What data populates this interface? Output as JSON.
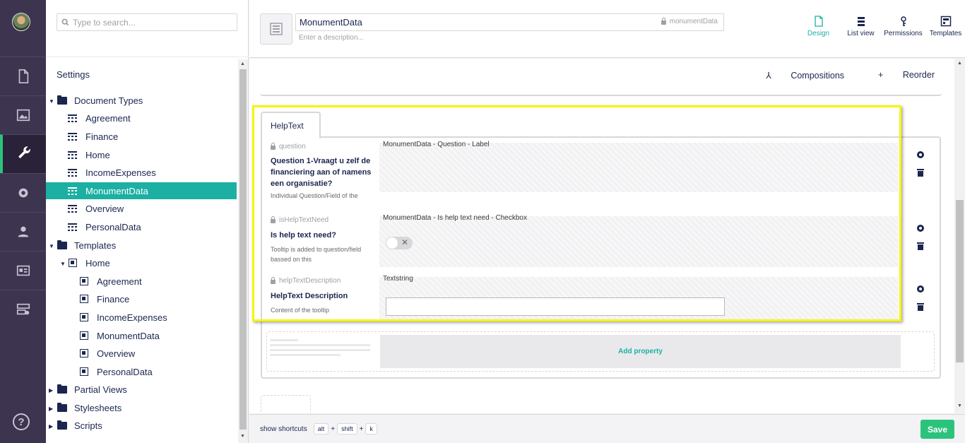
{
  "search": {
    "placeholder": "Type to search..."
  },
  "tree": {
    "section_title": "Settings",
    "document_types": {
      "label": "Document Types",
      "items": [
        "Agreement",
        "Finance",
        "Home",
        "IncomeExpenses",
        "MonumentData",
        "Overview",
        "PersonalData"
      ],
      "selected": "MonumentData"
    },
    "templates": {
      "label": "Templates",
      "home": "Home",
      "items": [
        "Agreement",
        "Finance",
        "IncomeExpenses",
        "MonumentData",
        "Overview",
        "PersonalData"
      ]
    },
    "partial_views": "Partial Views",
    "stylesheets": "Stylesheets",
    "scripts": "Scripts"
  },
  "header": {
    "name": "MonumentData",
    "alias": "monumentData",
    "description_placeholder": "Enter a description...",
    "apps": [
      {
        "label": "Design",
        "icon": "document-icon",
        "active": true
      },
      {
        "label": "List view",
        "icon": "list-view-icon",
        "active": false
      },
      {
        "label": "Permissions",
        "icon": "permissions-icon",
        "active": false
      },
      {
        "label": "Templates",
        "icon": "templates-icon",
        "active": false
      }
    ]
  },
  "toolbar": {
    "compositions": "Compositions",
    "reorder": "Reorder"
  },
  "group": {
    "tab": "HelpText",
    "properties": [
      {
        "alias": "question",
        "label": "Question 1-Vraagt u zelf de financiering aan of namens een organisatie?",
        "description": "Individual Question/Field of the",
        "editor": "MonumentData - Question - Label"
      },
      {
        "alias": "isHelpTextNeed",
        "label": "Is help text need?",
        "description": "Tooltip is added to question/field bassed on this",
        "editor": "MonumentData - Is help text need - Checkbox"
      },
      {
        "alias": "helpTextDescription",
        "label": "HelpText Description",
        "description": "Content of the tooltip",
        "editor": "Textstring"
      }
    ],
    "add_property": "Add property"
  },
  "footer": {
    "show_shortcuts": "show shortcuts",
    "keys": [
      "alt",
      "shift",
      "k"
    ],
    "plus": "+",
    "save": "Save"
  },
  "colors": {
    "accent": "#1cb0a3",
    "save": "#2bc37c",
    "rail": "#3d3450",
    "highlight": "#f5f50a"
  }
}
